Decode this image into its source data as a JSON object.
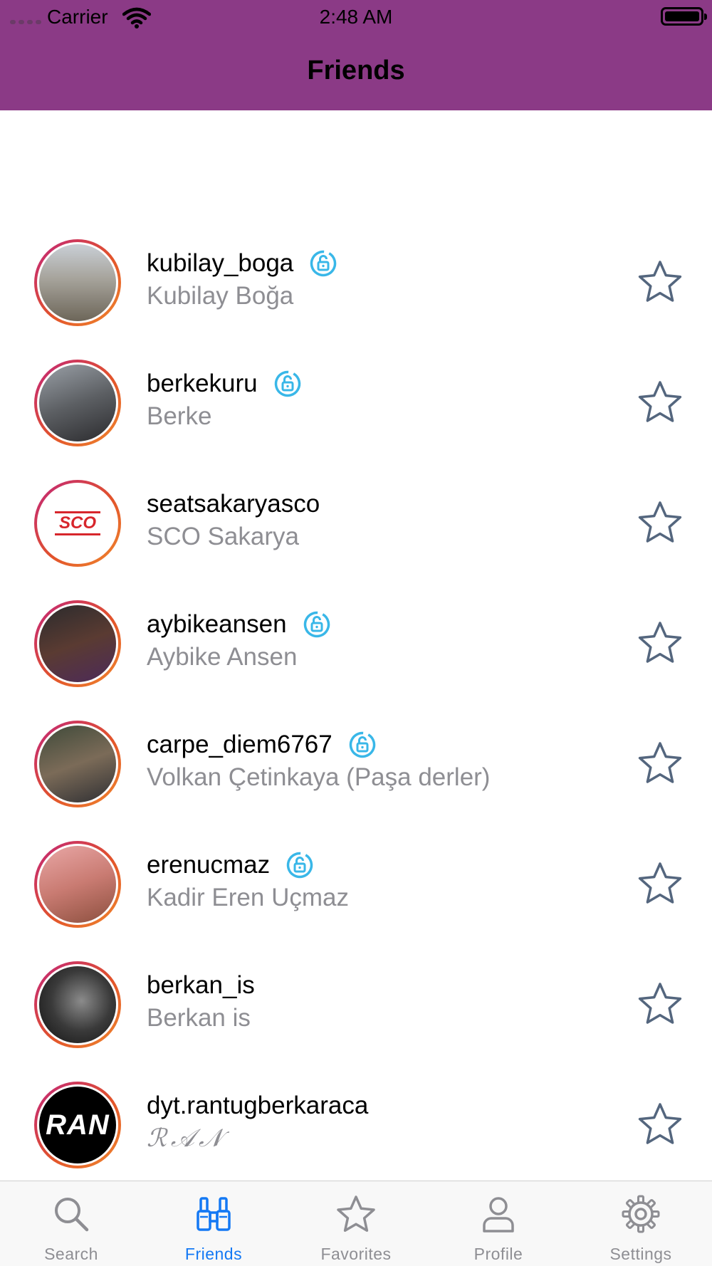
{
  "status_bar": {
    "carrier": "Carrier",
    "time": "2:48 AM"
  },
  "nav": {
    "title": "Friends"
  },
  "colors": {
    "header": "#8b3a86",
    "tab_active": "#1479f4",
    "tab_inactive": "#8e8e93",
    "lock": "#39b7e8",
    "star": "#54667e"
  },
  "friends": [
    {
      "username": "kubilay_boga",
      "full_name": "Kubilay Boğa",
      "locked": true
    },
    {
      "username": "berkekuru",
      "full_name": "Berke",
      "locked": true
    },
    {
      "username": "seatsakaryasco",
      "full_name": "SCO Sakarya",
      "locked": false,
      "avatar_text": "SCO"
    },
    {
      "username": "aybikeansen",
      "full_name": "Aybike Ansen",
      "locked": true
    },
    {
      "username": "carpe_diem6767",
      "full_name": "Volkan Çetinkaya (Paşa derler)",
      "locked": true
    },
    {
      "username": "erenucmaz",
      "full_name": "Kadir Eren Uçmaz",
      "locked": true
    },
    {
      "username": "berkan_is",
      "full_name": "Berkan is",
      "locked": false
    },
    {
      "username": "dyt.rantugberkaraca",
      "full_name": "ℛ𝒜𝒩",
      "locked": false,
      "avatar_text": "RAN"
    }
  ],
  "tabs": [
    {
      "label": "Search",
      "icon": "search-icon",
      "active": false
    },
    {
      "label": "Friends",
      "icon": "binoculars-icon",
      "active": true
    },
    {
      "label": "Favorites",
      "icon": "star-icon",
      "active": false
    },
    {
      "label": "Profile",
      "icon": "person-icon",
      "active": false
    },
    {
      "label": "Settings",
      "icon": "gear-icon",
      "active": false
    }
  ]
}
